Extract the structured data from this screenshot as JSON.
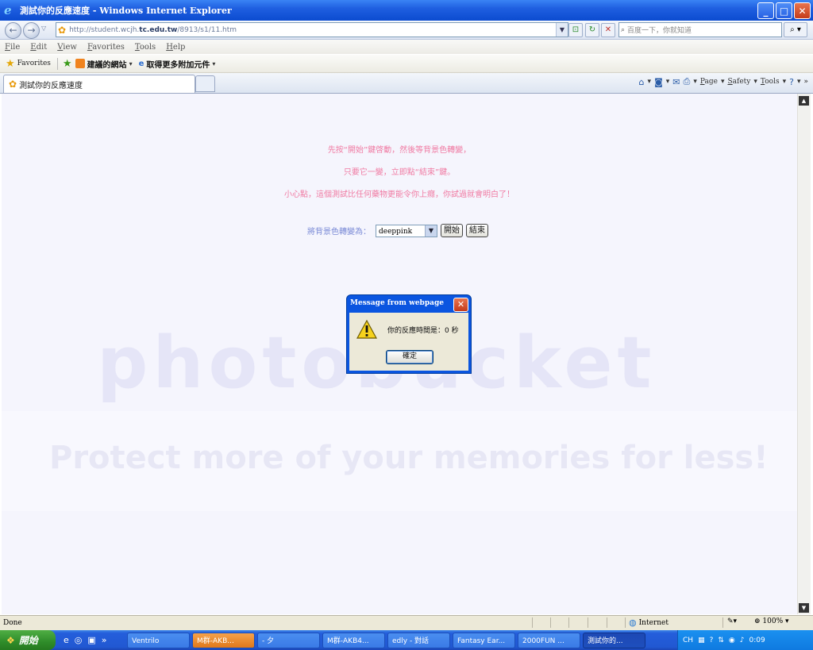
{
  "window": {
    "title": "測試你的反應速度 - Windows Internet Explorer"
  },
  "address": {
    "url_prefix": "http://student.wcjh.",
    "url_domain": "tc.edu.tw",
    "url_suffix": "/8913/s1/11.htm",
    "search_placeholder": "百度一下，你就知道"
  },
  "menu": [
    "File",
    "Edit",
    "View",
    "Favorites",
    "Tools",
    "Help"
  ],
  "favorites": {
    "label": "Favorites",
    "suggested": "建議的網站",
    "addons": "取得更多附加元件"
  },
  "tab": {
    "label": "測試你的反應速度"
  },
  "commands": {
    "page": "Page",
    "safety": "Safety",
    "tools": "Tools"
  },
  "page": {
    "line1": "先按“開始”鍵啓動，然後等背景色轉變，",
    "line2": "只要它一變，立即點“結束”鍵。",
    "line3": "小心點，這個測試比任何藥物更能令你上癮，你試過就會明白了！",
    "select_label": "將背景色轉變為：",
    "select_value": "deeppink",
    "start_button": "開始",
    "end_button": "結束",
    "watermark": "photobucket",
    "watermark_band": "Protect more of your memories for less!"
  },
  "dialog": {
    "title": "Message from webpage",
    "message": "你的反應時間是：0 秒",
    "ok": "確定"
  },
  "status": {
    "text": "Done",
    "zone": "Internet",
    "zoom": "100%"
  },
  "taskbar": {
    "start": "開始",
    "tasks": [
      {
        "label": "Ventrilo",
        "state": "normal",
        "width": 82
      },
      {
        "label": "M群-AKB...",
        "state": "flash",
        "width": 82
      },
      {
        "label": "- 夕",
        "state": "normal",
        "width": 82
      },
      {
        "label": "M群-AKB4...",
        "state": "normal",
        "width": 82
      },
      {
        "label": "edly - 對話",
        "state": "normal",
        "width": 82
      },
      {
        "label": "Fantasy Ear...",
        "state": "normal",
        "width": 82
      },
      {
        "label": "2000FUN ...",
        "state": "normal",
        "width": 82
      },
      {
        "label": "測試你的...",
        "state": "active",
        "width": 82
      }
    ],
    "lang": "CH",
    "clock": "0:09"
  }
}
